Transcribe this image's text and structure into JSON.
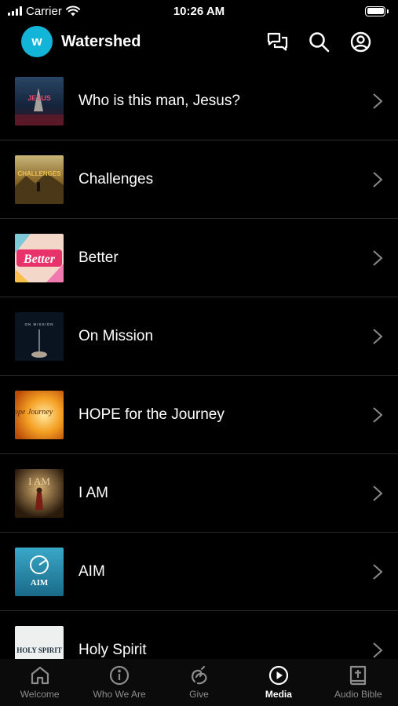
{
  "status_bar": {
    "carrier": "Carrier",
    "time": "10:26 AM"
  },
  "header": {
    "logo_letter": "w",
    "title": "Watershed",
    "brand_color": "#12b5d8",
    "actions": [
      "chat-icon",
      "search-icon",
      "account-icon"
    ]
  },
  "media": {
    "items": [
      {
        "label": "Who is this man, Jesus?",
        "thumb_text": "JESUS"
      },
      {
        "label": "Challenges",
        "thumb_text": "CHALLENGES"
      },
      {
        "label": "Better",
        "thumb_text": "Better"
      },
      {
        "label": "On Mission",
        "thumb_text": "ON MISSION"
      },
      {
        "label": "HOPE for the Journey",
        "thumb_text": "Hope Journey"
      },
      {
        "label": "I AM",
        "thumb_text": "I AM"
      },
      {
        "label": "AIM",
        "thumb_text": "AIM"
      },
      {
        "label": "Holy Spirit",
        "thumb_text": "HOLY SPIRIT"
      }
    ]
  },
  "tabs": [
    {
      "label": "Welcome",
      "icon": "home-icon",
      "active": false
    },
    {
      "label": "Who We Are",
      "icon": "info-icon",
      "active": false
    },
    {
      "label": "Give",
      "icon": "give-icon",
      "active": false
    },
    {
      "label": "Media",
      "icon": "play-icon",
      "active": true
    },
    {
      "label": "Audio Bible",
      "icon": "bible-icon",
      "active": false
    }
  ]
}
